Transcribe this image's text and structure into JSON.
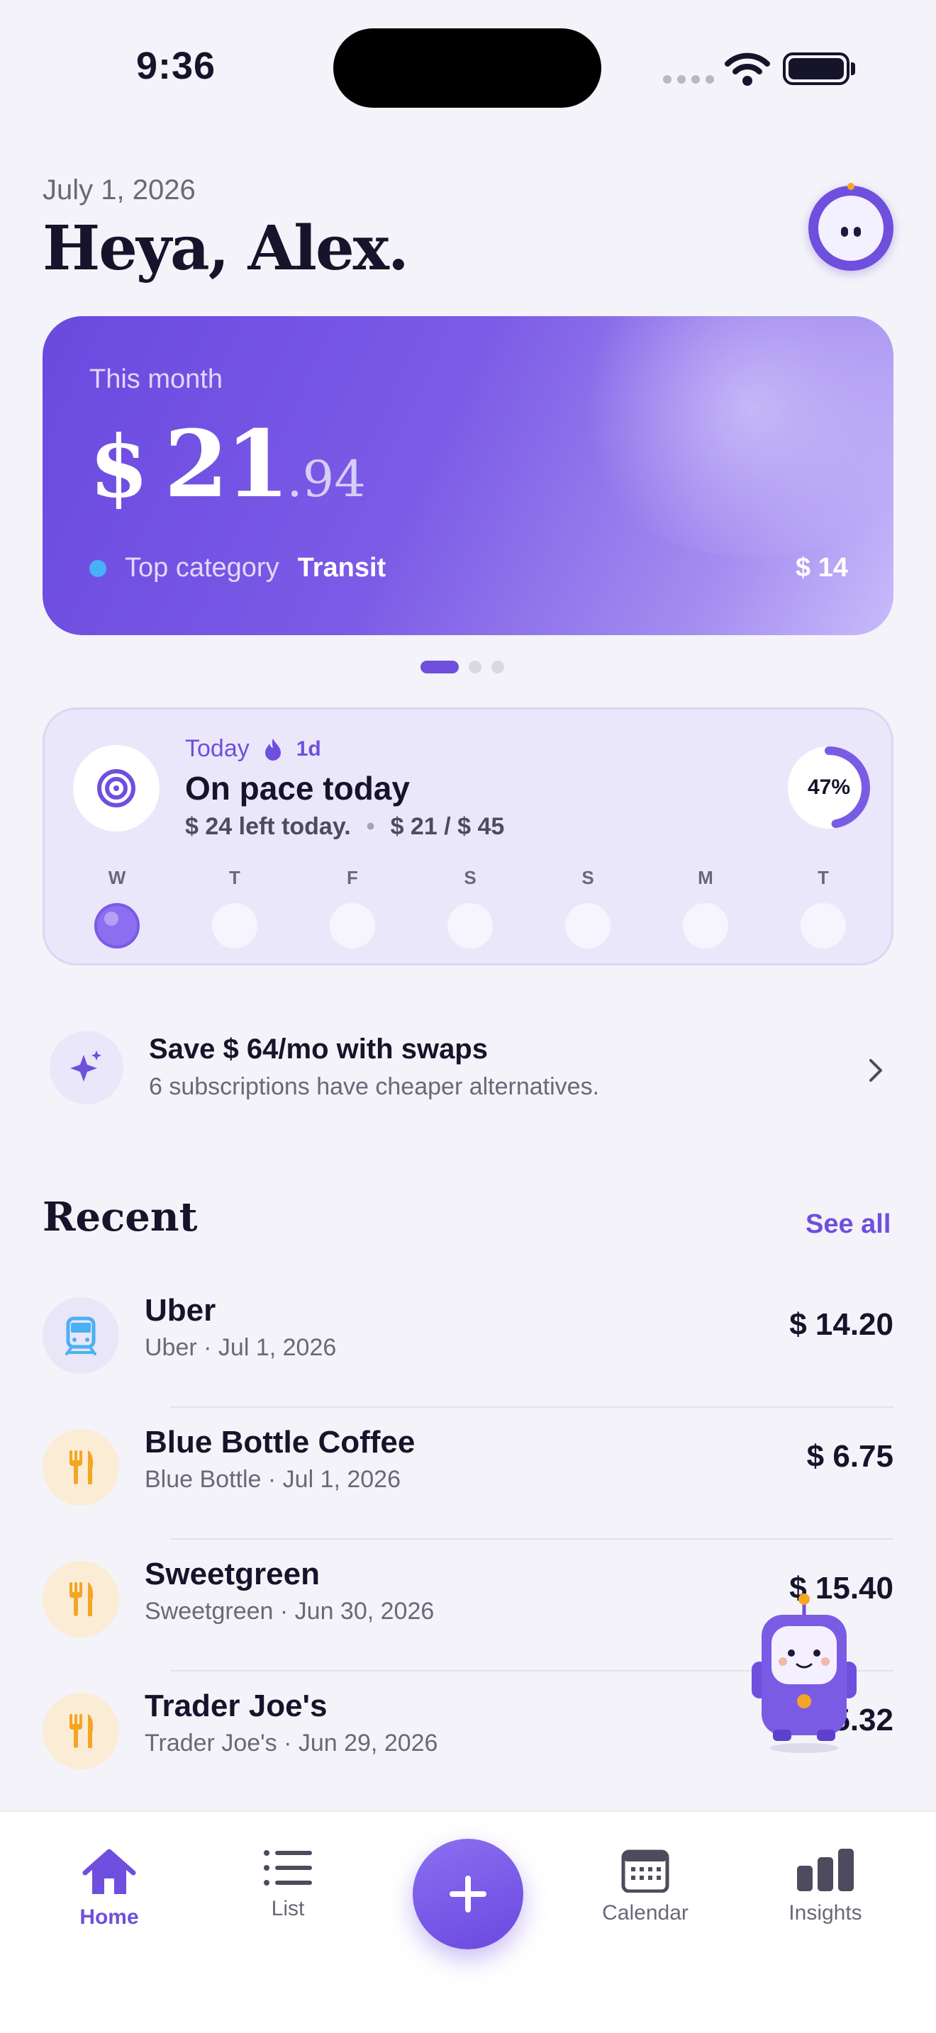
{
  "status_bar": {
    "time": "9:36"
  },
  "header": {
    "date": "July 1, 2026",
    "greeting": "Heya, Alex."
  },
  "hero": {
    "label": "This month",
    "currency": "$",
    "amount_int": "21",
    "amount_dec": ".94",
    "top_category_label": "Top category",
    "top_category": "Transit",
    "top_category_amount": "$ 14",
    "page_index": 1,
    "page_count": 3
  },
  "pace": {
    "today_label": "Today",
    "streak": "1d",
    "title": "On pace today",
    "left_text": "$ 24 left today.",
    "separator": "•",
    "ratio_text": "$ 21 / $ 45",
    "percent_label": "47%",
    "percent": 0.47,
    "days": [
      "W",
      "T",
      "F",
      "S",
      "S",
      "M",
      "T"
    ],
    "active_day_index": 0
  },
  "swaps": {
    "title": "Save $ 64/mo with swaps",
    "subtitle": "6 subscriptions have cheaper alternatives."
  },
  "recent": {
    "title": "Recent",
    "see_all": "See all",
    "items": [
      {
        "name": "Uber",
        "meta": "Uber · Jul 1, 2026",
        "amount": "$ 14.20",
        "icon": "train-icon"
      },
      {
        "name": "Blue Bottle Coffee",
        "meta": "Blue Bottle · Jul 1, 2026",
        "amount": "$ 6.75",
        "icon": "fork-knife-icon"
      },
      {
        "name": "Sweetgreen",
        "meta": "Sweetgreen · Jun 30, 2026",
        "amount": "$ 15.40",
        "icon": "fork-knife-icon"
      },
      {
        "name": "Trader Joe's",
        "meta": "Trader Joe's · Jun 29, 2026",
        "amount": "$ 5.32",
        "icon": "fork-knife-icon"
      }
    ]
  },
  "tabbar": {
    "home": "Home",
    "list": "List",
    "calendar": "Calendar",
    "insights": "Insights"
  },
  "colors": {
    "accent": "#6f4fdd",
    "background": "#f4f3f9",
    "transit_dot": "#4ab0f5",
    "food_icon": "#f5a524"
  }
}
